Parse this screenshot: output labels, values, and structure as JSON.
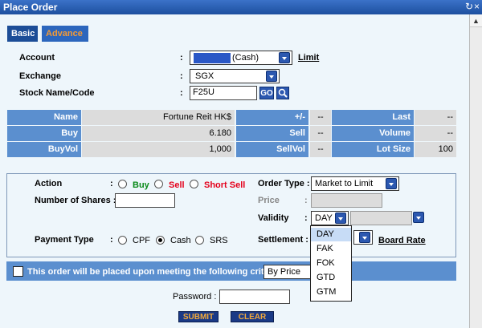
{
  "window": {
    "title": "Place Order",
    "title_icons": "↻×"
  },
  "tabs": [
    {
      "label": "Basic"
    },
    {
      "label": "Advance"
    }
  ],
  "form": {
    "account_label": "Account",
    "account_value": "(Cash)",
    "limit_link": "Limit",
    "exchange_label": "Exchange",
    "exchange_value": "SGX",
    "stock_label": "Stock Name/Code",
    "stock_value": "F25U",
    "go_label": "GO",
    "colon": ":"
  },
  "info_table": {
    "rows": [
      [
        {
          "h": "Name"
        },
        {
          "v": "Fortune Reit HK$"
        },
        {
          "h": "+/-"
        },
        {
          "v": "--"
        },
        {
          "h": "Last"
        },
        {
          "v": "--"
        }
      ],
      [
        {
          "h": "Buy"
        },
        {
          "v": "6.180"
        },
        {
          "h": "Sell"
        },
        {
          "v": "--"
        },
        {
          "h": "Volume"
        },
        {
          "v": "--"
        }
      ],
      [
        {
          "h": "BuyVol"
        },
        {
          "v": "1,000"
        },
        {
          "h": "SellVol"
        },
        {
          "v": "--"
        },
        {
          "h": "Lot Size"
        },
        {
          "v": "100"
        }
      ]
    ]
  },
  "order": {
    "action_label": "Action",
    "action_colon": ":",
    "buy": "Buy",
    "sell": "Sell",
    "short_sell": "Short Sell",
    "shares_label": "Number of Shares :",
    "order_type_label": "Order Type :",
    "order_type_value": "Market to Limit",
    "price_label": "Price",
    "price_colon": ":",
    "validity_label": "Validity",
    "validity_colon": ":",
    "validity_value": "DAY",
    "payment_label": "Payment Type",
    "payment_colon": ":",
    "cpf": "CPF",
    "cash": "Cash",
    "srs": "SRS",
    "settlement_label": "Settlement :",
    "board_rate": "Board Rate"
  },
  "criteria": {
    "text": "This order will be placed upon meeting the following criteria:",
    "select_value": "By Price"
  },
  "validity_options": [
    "DAY",
    "FAK",
    "FOK",
    "GTD",
    "GTM"
  ],
  "password_label": "Password :",
  "submit_label": "SUBMIT",
  "clear_label": "CLEAR"
}
